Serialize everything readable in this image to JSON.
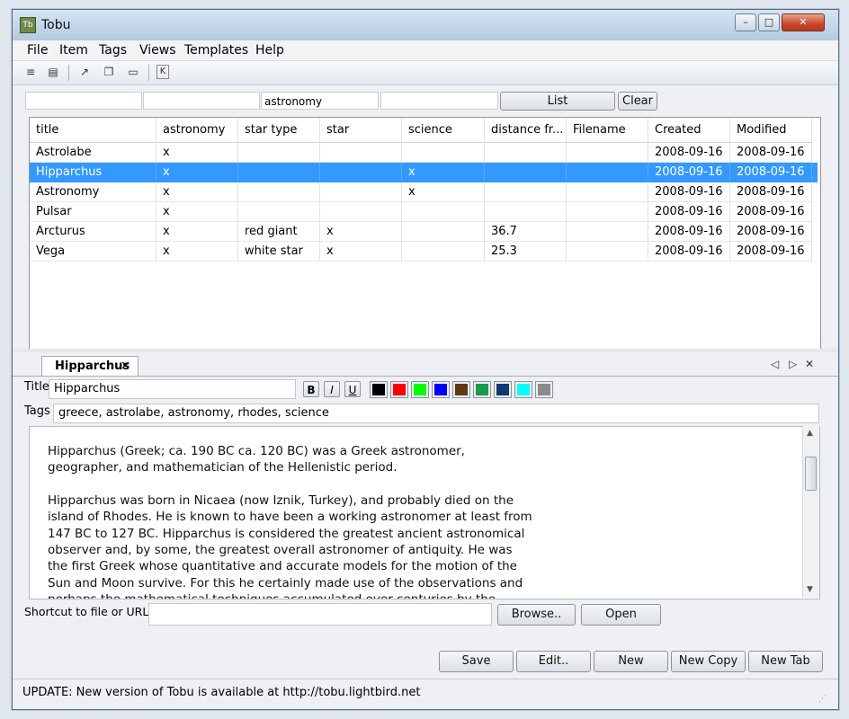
{
  "window": {
    "title": "Tobu",
    "minimize": "–",
    "maximize": "□",
    "close": "✕",
    "app_icon": "Tb"
  },
  "menu": [
    "File",
    "Item",
    "Tags",
    "Views",
    "Templates",
    "Help"
  ],
  "toolbar_icons": [
    "list-icon",
    "bookmark-icon",
    "export-icon",
    "copy-icon",
    "folder-icon",
    "k-icon"
  ],
  "toolbar_glyphs": [
    "≡",
    "▤",
    "↗",
    "❐",
    "▭",
    "K"
  ],
  "filters": [
    "",
    "",
    "astronomy",
    ""
  ],
  "buttons": {
    "list": "List",
    "clear": "Clear"
  },
  "grid": {
    "columns": [
      "title",
      "astronomy",
      "star type",
      "star",
      "science",
      "distance fr...",
      "Filename",
      "Created",
      "Modified"
    ],
    "rows": [
      [
        "Astrolabe",
        "x",
        "",
        "",
        "",
        "",
        "",
        "2008-09-16",
        "2008-09-16"
      ],
      [
        "Hipparchus",
        "x",
        "",
        "",
        "x",
        "",
        "",
        "2008-09-16",
        "2008-09-16"
      ],
      [
        "Astronomy",
        "x",
        "",
        "",
        "x",
        "",
        "",
        "2008-09-16",
        "2008-09-16"
      ],
      [
        "Pulsar",
        "x",
        "",
        "",
        "",
        "",
        "",
        "2008-09-16",
        "2008-09-16"
      ],
      [
        "Arcturus",
        "x",
        "red giant",
        "x",
        "",
        "36.7",
        "",
        "2008-09-16",
        "2008-09-16"
      ],
      [
        "Vega",
        "x",
        "white star",
        "x",
        "",
        "25.3",
        "",
        "2008-09-16",
        "2008-09-16"
      ]
    ],
    "selected_row": 1
  },
  "tab": {
    "label": "Hipparchus",
    "close": "✕"
  },
  "tab_nav": {
    "prev": "◁",
    "next": "▷",
    "close": "✕"
  },
  "editor": {
    "title_label": "Title",
    "title_value": "Hipparchus",
    "tags_label": "Tags",
    "tags_value": "greece, astrolabe, astronomy, rhodes, science",
    "format": {
      "bold": "B",
      "italic": "I",
      "underline": "U"
    },
    "colors": [
      "#000000",
      "#ff0000",
      "#00ff00",
      "#0000ff",
      "#5c3a12",
      "#1a9a4a",
      "#0d3a70",
      "#00ffff",
      "#8a8a8a"
    ],
    "paragraphs": [
      "Hipparchus (Greek; ca. 190 BC ca. 120 BC) was a Greek astronomer, geographer, and mathematician of the Hellenistic period.",
      "Hipparchus was born in Nicaea (now Iznik, Turkey), and probably died on the island of Rhodes. He is known to have been a working astronomer at least from 147 BC to 127 BC. Hipparchus is considered the greatest ancient astronomical observer and, by some, the greatest overall astronomer of antiquity. He was the first Greek whose quantitative and accurate models for the motion of the Sun and Moon survive. For this he certainly made use of the observations and perhaps the mathematical techniques accumulated over centuries by the"
    ],
    "shortcut_label": "Shortcut to file or URL:",
    "shortcut_value": "",
    "browse": "Browse..",
    "open": "Open"
  },
  "actions": {
    "save": "Save",
    "edit": "Edit..",
    "new": "New",
    "new_copy": "New Copy",
    "new_tab": "New Tab"
  },
  "status": "UPDATE: New version of Tobu is available at http://tobu.lightbird.net"
}
